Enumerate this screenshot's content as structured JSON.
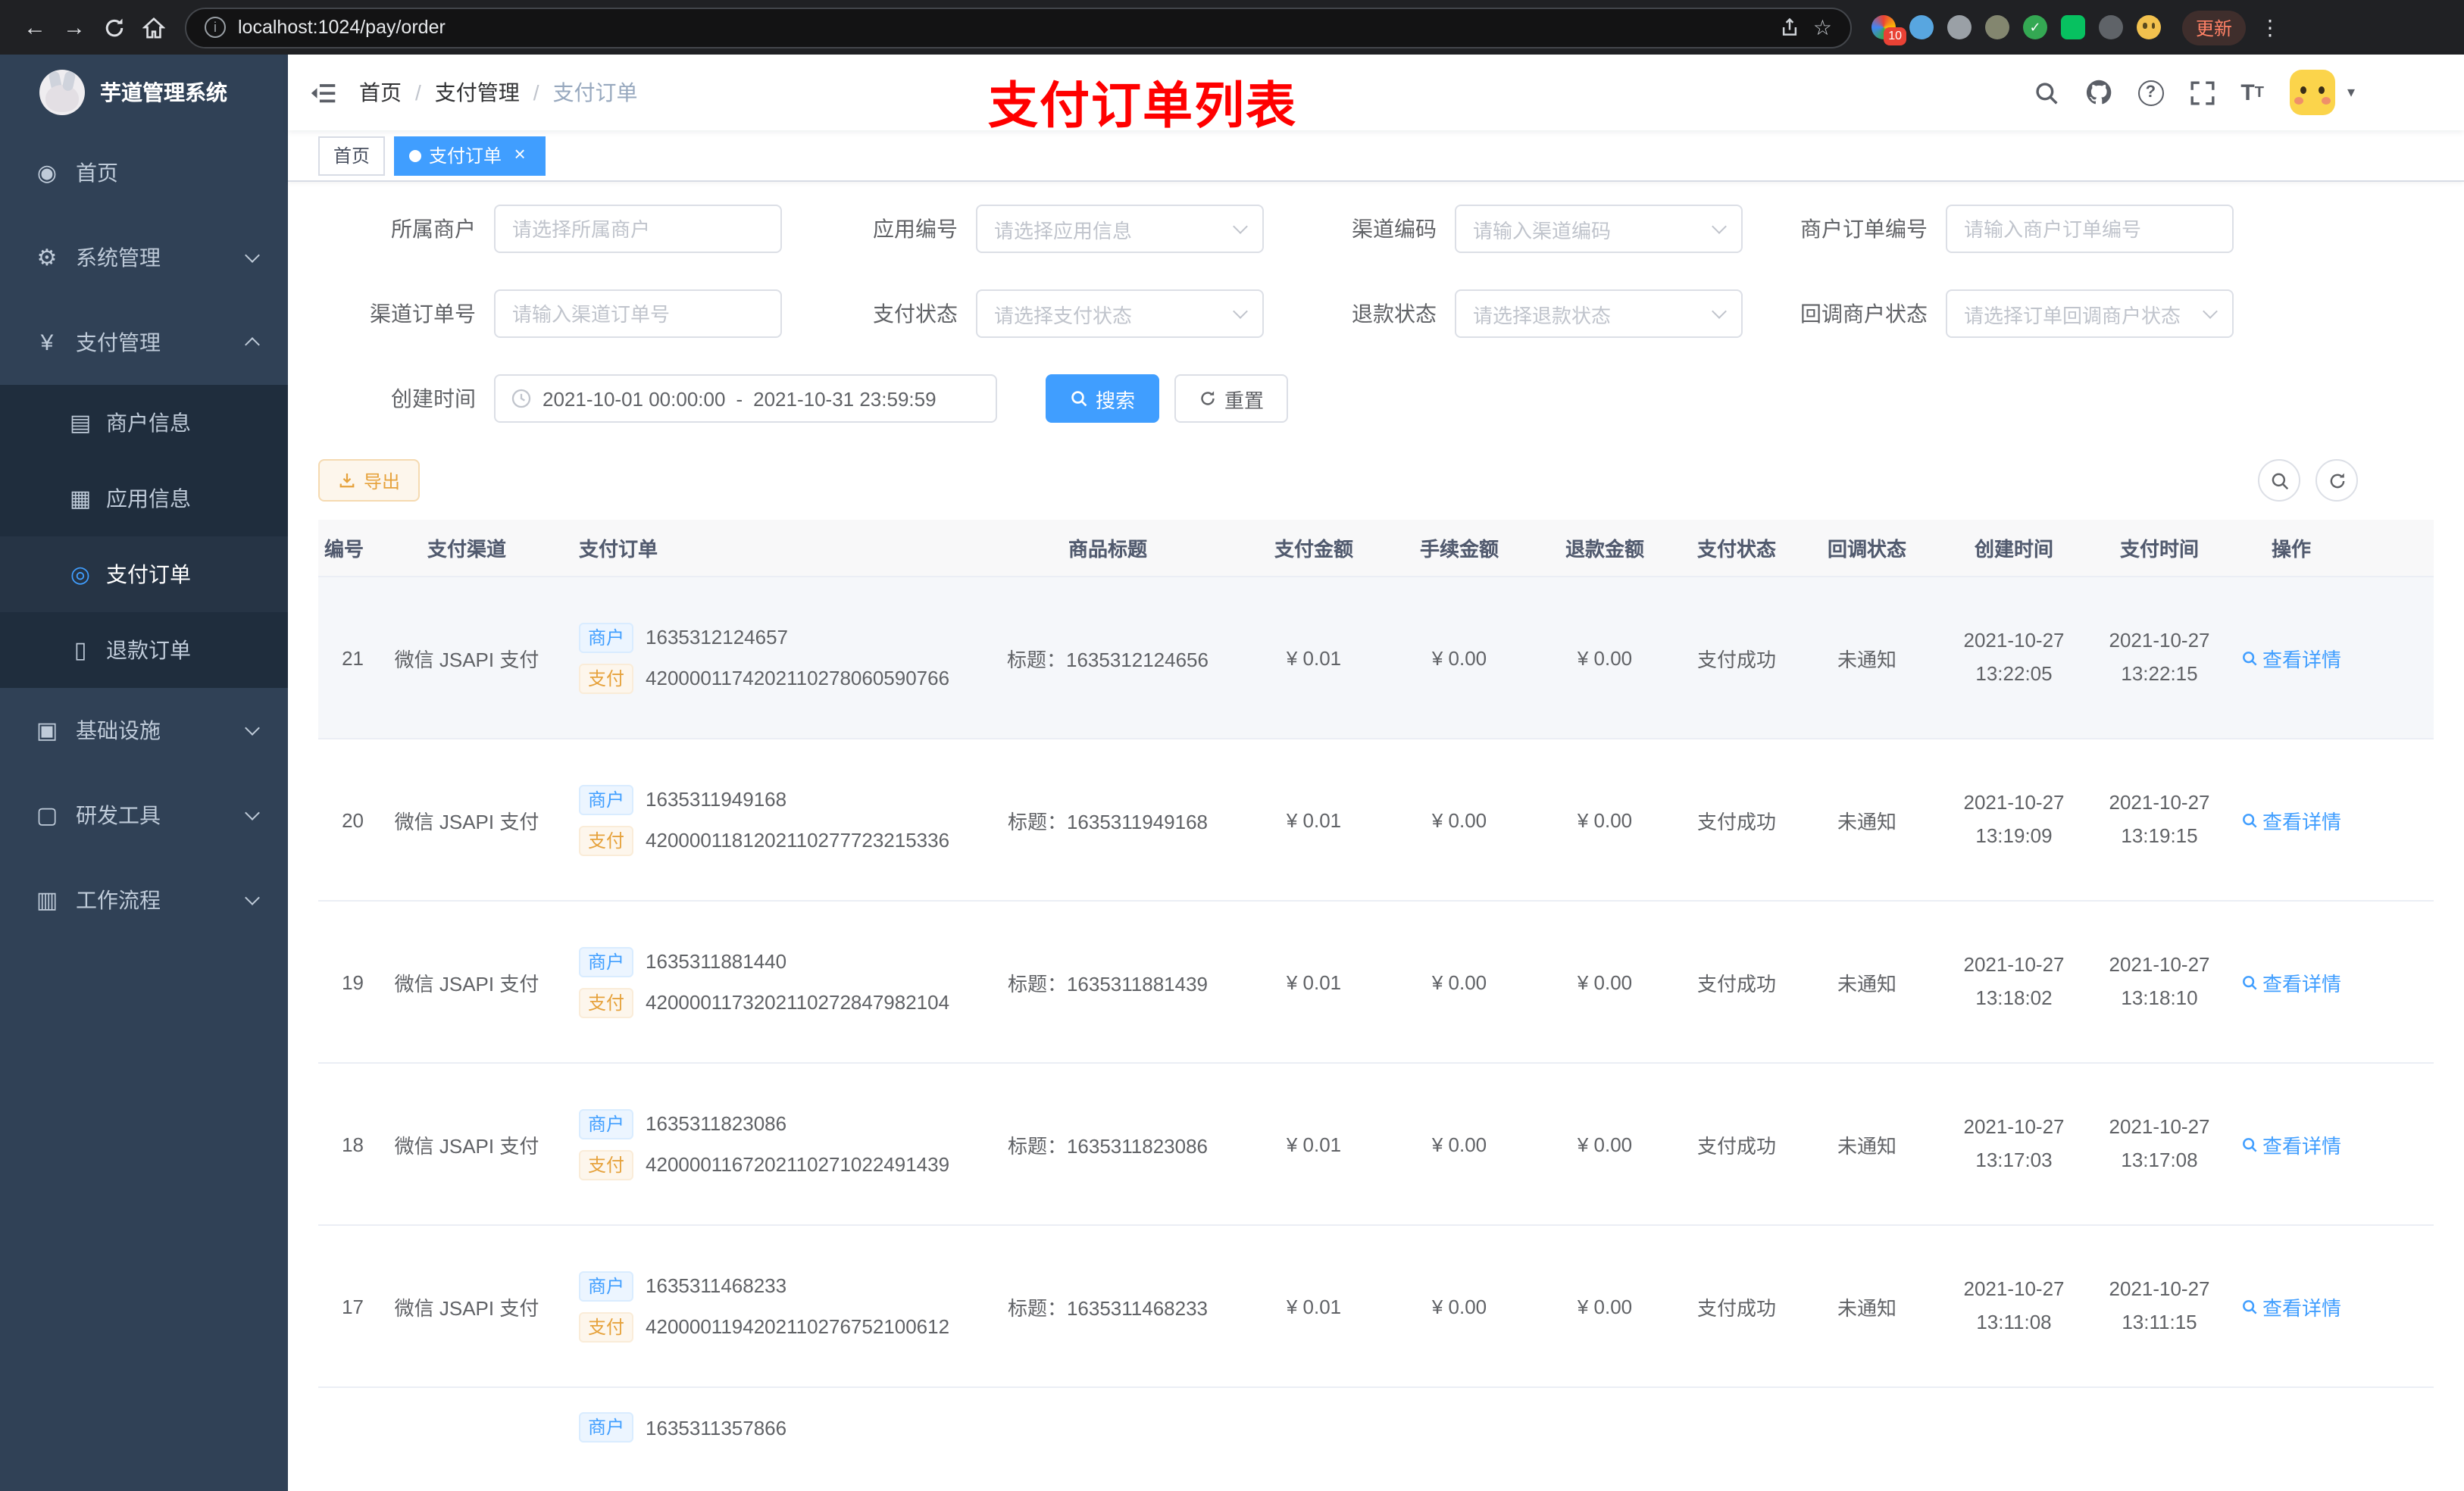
{
  "browser": {
    "url": "localhost:1024/pay/order",
    "update_label": "更新",
    "extension_badge": "10"
  },
  "icons": {
    "back": "←",
    "forward": "→",
    "star": "☆",
    "menu_dots": "⋮",
    "close": "×",
    "question": "?",
    "caret_down": "▾",
    "info": "i",
    "check": "✓",
    "font_size_large": "T",
    "font_size_small": "T",
    "dashboard": "◉",
    "gear": "⚙",
    "yen": "¥",
    "merchant": "▤",
    "app": "▦",
    "pay_order": "◎",
    "refund": "▯",
    "infra": "▣",
    "tools": "▢",
    "workflow": "▥"
  },
  "app_title": "芋道管理系统",
  "sidebar": {
    "items": [
      {
        "label": "首页"
      },
      {
        "label": "系统管理"
      },
      {
        "label": "支付管理"
      },
      {
        "label": "商户信息"
      },
      {
        "label": "应用信息"
      },
      {
        "label": "支付订单"
      },
      {
        "label": "退款订单"
      },
      {
        "label": "基础设施"
      },
      {
        "label": "研发工具"
      },
      {
        "label": "工作流程"
      }
    ]
  },
  "header": {
    "breadcrumb": [
      "首页",
      "支付管理",
      "支付订单"
    ],
    "sep": "/",
    "page_annotation": "支付订单列表"
  },
  "tabs": [
    {
      "label": "首页",
      "active": false
    },
    {
      "label": "支付订单",
      "active": true,
      "closable": true
    }
  ],
  "filters": {
    "row1": [
      {
        "label": "所属商户",
        "placeholder": "请选择所属商户",
        "control": "input"
      },
      {
        "label": "应用编号",
        "placeholder": "请选择应用信息",
        "control": "select"
      },
      {
        "label": "渠道编码",
        "placeholder": "请输入渠道编码",
        "control": "select"
      },
      {
        "label": "商户订单编号",
        "placeholder": "请输入商户订单编号",
        "control": "input"
      }
    ],
    "row2": [
      {
        "label": "渠道订单号",
        "placeholder": "请输入渠道订单号",
        "control": "input"
      },
      {
        "label": "支付状态",
        "placeholder": "请选择支付状态",
        "control": "select"
      },
      {
        "label": "退款状态",
        "placeholder": "请选择退款状态",
        "control": "select"
      },
      {
        "label": "回调商户状态",
        "placeholder": "请选择订单回调商户状态",
        "control": "select"
      }
    ],
    "date": {
      "label": "创建时间",
      "start": "2021-10-01 00:00:00",
      "separator": "-",
      "end": "2021-10-31 23:59:59"
    },
    "search_label": "搜索",
    "reset_label": "重置"
  },
  "toolbar": {
    "export_label": "导出"
  },
  "table": {
    "columns": [
      "编号",
      "支付渠道",
      "支付订单",
      "商品标题",
      "支付金额",
      "手续金额",
      "退款金额",
      "支付状态",
      "回调状态",
      "创建时间",
      "支付时间",
      "操作"
    ],
    "tag_merchant": "商户",
    "tag_pay": "支付",
    "action_label": "查看详情",
    "rows": [
      {
        "id": "21",
        "channel": "微信 JSAPI 支付",
        "merchant_no": "1635312124657",
        "pay_no": "4200001174202110278060590766",
        "title": "标题：1635312124656",
        "amount": "¥ 0.01",
        "fee": "¥ 0.00",
        "refund": "¥ 0.00",
        "status": "支付成功",
        "notify": "未通知",
        "created_date": "2021-10-27",
        "created_time": "13:22:05",
        "paid_date": "2021-10-27",
        "paid_time": "13:22:15"
      },
      {
        "id": "20",
        "channel": "微信 JSAPI 支付",
        "merchant_no": "1635311949168",
        "pay_no": "4200001181202110277723215336",
        "title": "标题：1635311949168",
        "amount": "¥ 0.01",
        "fee": "¥ 0.00",
        "refund": "¥ 0.00",
        "status": "支付成功",
        "notify": "未通知",
        "created_date": "2021-10-27",
        "created_time": "13:19:09",
        "paid_date": "2021-10-27",
        "paid_time": "13:19:15"
      },
      {
        "id": "19",
        "channel": "微信 JSAPI 支付",
        "merchant_no": "1635311881440",
        "pay_no": "4200001173202110272847982104",
        "title": "标题：1635311881439",
        "amount": "¥ 0.01",
        "fee": "¥ 0.00",
        "refund": "¥ 0.00",
        "status": "支付成功",
        "notify": "未通知",
        "created_date": "2021-10-27",
        "created_time": "13:18:02",
        "paid_date": "2021-10-27",
        "paid_time": "13:18:10"
      },
      {
        "id": "18",
        "channel": "微信 JSAPI 支付",
        "merchant_no": "1635311823086",
        "pay_no": "4200001167202110271022491439",
        "title": "标题：1635311823086",
        "amount": "¥ 0.01",
        "fee": "¥ 0.00",
        "refund": "¥ 0.00",
        "status": "支付成功",
        "notify": "未通知",
        "created_date": "2021-10-27",
        "created_time": "13:17:03",
        "paid_date": "2021-10-27",
        "paid_time": "13:17:08"
      },
      {
        "id": "17",
        "channel": "微信 JSAPI 支付",
        "merchant_no": "1635311468233",
        "pay_no": "4200001194202110276752100612",
        "title": "标题：1635311468233",
        "amount": "¥ 0.01",
        "fee": "¥ 0.00",
        "refund": "¥ 0.00",
        "status": "支付成功",
        "notify": "未通知",
        "created_date": "2021-10-27",
        "created_time": "13:11:08",
        "paid_date": "2021-10-27",
        "paid_time": "13:11:15"
      }
    ],
    "partial_row": {
      "merchant_no": "1635311357866"
    }
  }
}
